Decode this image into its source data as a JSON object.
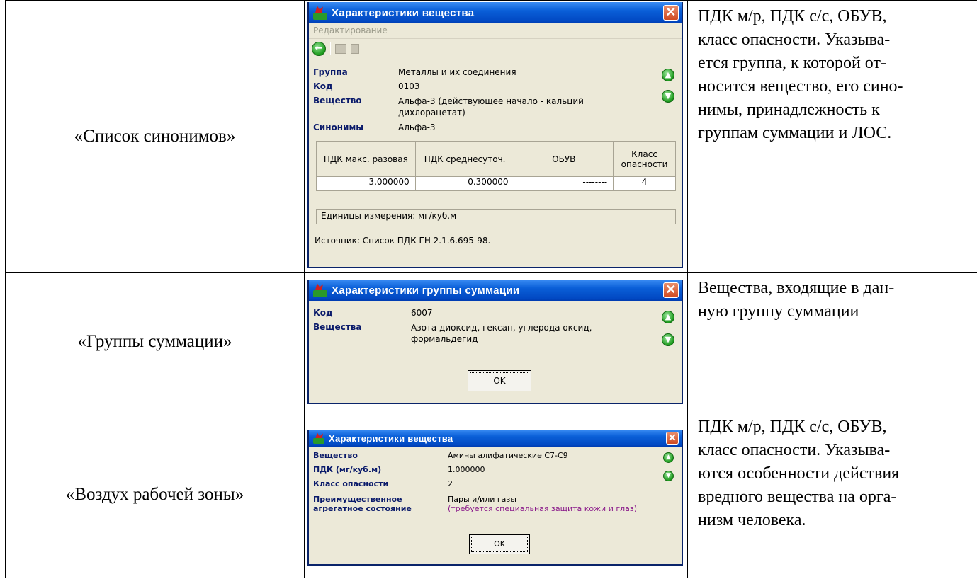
{
  "rows": [
    {
      "label": "«Список синонимов»",
      "description_lines": [
        "ПДК м/р, ПДК с/с, ОБУВ,",
        "класс опасности. Указыва-",
        "ется группа, к которой от-",
        "носится вещество, его сино-",
        "нимы, принадлежность к",
        "группам суммации и ЛОС."
      ],
      "dialog": {
        "title": "Характеристики вещества",
        "close": "✕",
        "menu": "Редактирование",
        "fields": [
          {
            "label": "Группа",
            "value": "Металлы и их соединения"
          },
          {
            "label": "Код",
            "value": "0103"
          },
          {
            "label": "Вещество",
            "value": "Альфа-3 (действующее начало - кальций дихлорацетат)"
          },
          {
            "label": "Синонимы",
            "value": "Альфа-3"
          }
        ],
        "grid_headers": [
          "ПДК макс. разовая",
          "ПДК среднесуточ.",
          "ОБУВ",
          "Класс опасности"
        ],
        "grid_values": [
          "3.000000",
          "0.300000",
          "--------",
          "4"
        ],
        "units": "Единицы измерения: мг/куб.м",
        "source": "Источник: Список ПДК ГН 2.1.6.695-98."
      }
    },
    {
      "label": "«Группы суммации»",
      "description_lines": [
        "Вещества, входящие в дан-",
        "ную группу суммации"
      ],
      "dialog": {
        "title": "Характеристики группы суммации",
        "close": "✕",
        "fields": [
          {
            "label": "Код",
            "value": "6007"
          },
          {
            "label": "Вещества",
            "value": "Азота диоксид, гексан, углерода оксид, формальдегид"
          }
        ],
        "ok": "OK"
      }
    },
    {
      "label": "«Воздух рабочей зоны»",
      "description_lines": [
        "ПДК м/р, ПДК с/с, ОБУВ,",
        "класс опасности. Указыва-",
        "ются особенности действия",
        "вредного вещества на орга-",
        "низм человека."
      ],
      "dialog": {
        "title": "Характеристики вещества",
        "close": "✕",
        "fields": [
          {
            "label": "Вещество",
            "value": "Амины алифатические С7-С9"
          },
          {
            "label": "ПДК (мг/куб.м)",
            "value": "1.000000"
          },
          {
            "label": "Класс опасности",
            "value": "2"
          },
          {
            "label": "Преимущественное агрегатное состояние",
            "value": "Пары и/или газы"
          }
        ],
        "note": "(требуется специальная защита кожи и глаз)",
        "ok": "OK"
      }
    }
  ],
  "icons": {
    "back": "back-arrow-icon",
    "up": "arrow-up-icon",
    "down": "arrow-down-icon",
    "app": "app-logo-icon"
  },
  "colors": {
    "titlebar": "#0a5fd8",
    "dialog_bg": "#ece9d8",
    "field_label": "#0a1a6a",
    "note": "#8a1a8a"
  }
}
